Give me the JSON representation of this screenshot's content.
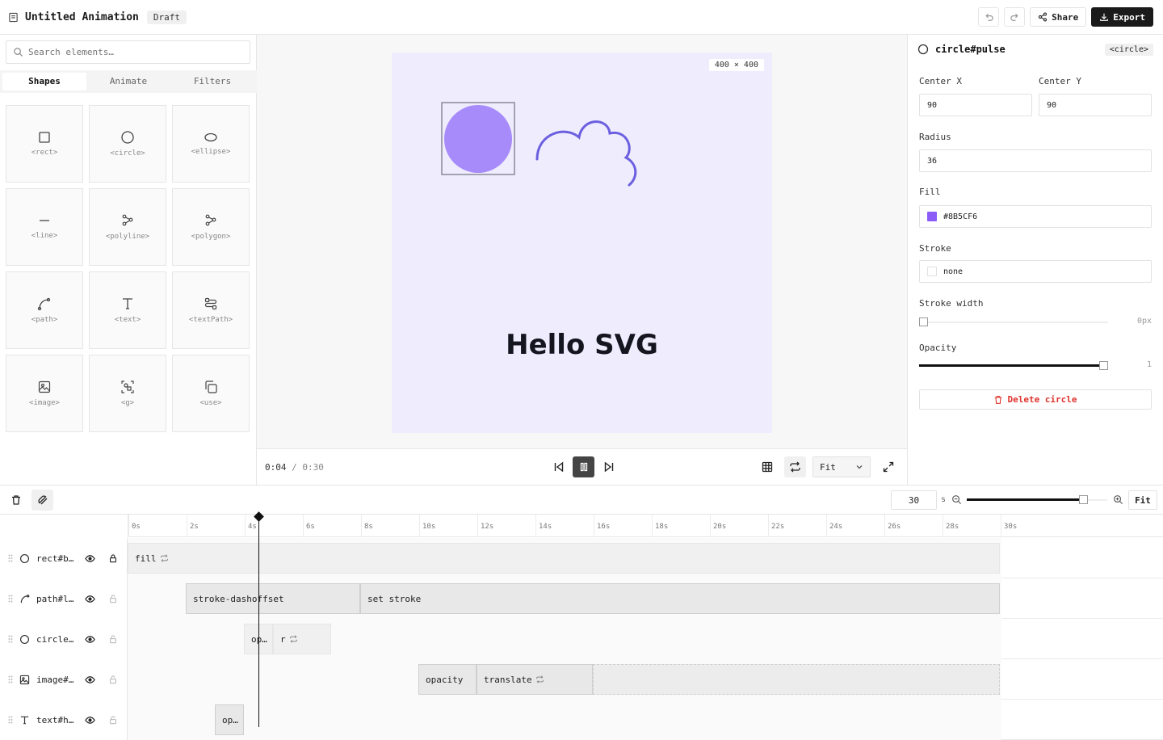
{
  "app": {
    "title": "Untitled Animation",
    "badge": "Draft",
    "share_label": "Share",
    "export_label": "Export"
  },
  "left": {
    "search_placeholder": "Search elements…",
    "tabs": [
      "Shapes",
      "Animate",
      "Filters"
    ],
    "tiles": [
      "<rect>",
      "<circle>",
      "<ellipse>",
      "<line>",
      "<polyline>",
      "<polygon>",
      "<path>",
      "<text>",
      "<textPath>",
      "<image>",
      "<g>",
      "<use>"
    ]
  },
  "canvas": {
    "dims": "400 × 400",
    "text": "Hello SVG",
    "circle_fill": "#A78BFA",
    "cloud_stroke": "#6B5FE0",
    "bg": "#EFECFD"
  },
  "playback": {
    "current": "0:04",
    "separator": "/",
    "total": "0:30",
    "zoom": "Fit"
  },
  "props": {
    "element": "circle#pulse",
    "tag": "<circle>",
    "center_x_label": "Center X",
    "center_x": "90",
    "center_y_label": "Center Y",
    "center_y": "90",
    "radius_label": "Radius",
    "radius": "36",
    "fill_label": "Fill",
    "fill": "#8B5CF6",
    "stroke_label": "Stroke",
    "stroke": "none",
    "stroke_width_label": "Stroke width",
    "stroke_width": "0px",
    "stroke_width_value": 0,
    "opacity_label": "Opacity",
    "opacity": "1",
    "opacity_value": 1,
    "delete_label": "Delete circle"
  },
  "timeline": {
    "duration": "30",
    "unit": "s",
    "zoom_label": "Fit",
    "zoom_level": 0.85,
    "ticks": [
      "0s",
      "2s",
      "4s",
      "6s",
      "8s",
      "10s",
      "12s",
      "14s",
      "16s",
      "18s",
      "20s",
      "22s",
      "24s",
      "26s",
      "28s",
      "30s"
    ],
    "playhead_time": 4.5,
    "rows": [
      {
        "name": "rect#b…",
        "icon": "circle-icon",
        "bars": [
          {
            "label": "fill",
            "start": 0,
            "end": 30,
            "repeat": true,
            "style": "light"
          }
        ]
      },
      {
        "name": "path#l…",
        "icon": "path-icon",
        "bars": [
          {
            "label": "stroke-dashoffset",
            "start": 2,
            "end": 8,
            "repeat": false,
            "style": "solid"
          },
          {
            "label": "set stroke",
            "start": 8,
            "end": 30,
            "repeat": false,
            "style": "solid"
          }
        ]
      },
      {
        "name": "circle…",
        "icon": "circle-icon",
        "bars": [
          {
            "label": "op…",
            "start": 4,
            "end": 5,
            "repeat": false,
            "style": "light"
          },
          {
            "label": "r",
            "start": 5,
            "end": 7,
            "repeat": true,
            "style": "light"
          }
        ]
      },
      {
        "name": "image#…",
        "icon": "image-icon",
        "bars": [
          {
            "label": "opacity",
            "start": 10,
            "end": 12,
            "repeat": false,
            "style": "solid"
          },
          {
            "label": "translate",
            "start": 12,
            "end": 16,
            "repeat": true,
            "style": "solid"
          },
          {
            "label": "",
            "start": 16,
            "end": 30,
            "repeat": false,
            "style": "dashed"
          }
        ]
      },
      {
        "name": "text#h…",
        "icon": "text-icon",
        "bars": [
          {
            "label": "op…",
            "start": 3,
            "end": 4,
            "repeat": false,
            "style": "solid"
          }
        ]
      }
    ]
  }
}
